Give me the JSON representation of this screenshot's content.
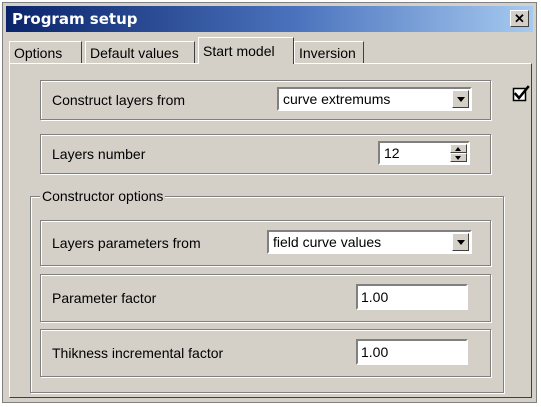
{
  "window": {
    "title": "Program setup",
    "close_glyph": "✕"
  },
  "tabs": [
    {
      "label": "Options",
      "active": false
    },
    {
      "label": "Default values",
      "active": false
    },
    {
      "label": "Start model",
      "active": true
    },
    {
      "label": "Inversion",
      "active": false
    }
  ],
  "start_model": {
    "construct_layers": {
      "label": "Construct layers from",
      "value": "curve extremums"
    },
    "layers_number": {
      "label": "Layers number",
      "value": "12"
    },
    "constructor_options": {
      "title": "Constructor options",
      "layers_parameters": {
        "label": "Layers parameters from",
        "value": "field curve values"
      },
      "parameter_factor": {
        "label": "Parameter factor",
        "value": "1.00"
      },
      "thickness_factor": {
        "label": "Thikness incremental factor",
        "value": "1.00"
      }
    }
  },
  "icons": {
    "apply": "checkmark-icon"
  },
  "colors": {
    "title_start": "#0a246a",
    "title_end": "#a6caf0",
    "face": "#d4d0c8"
  }
}
